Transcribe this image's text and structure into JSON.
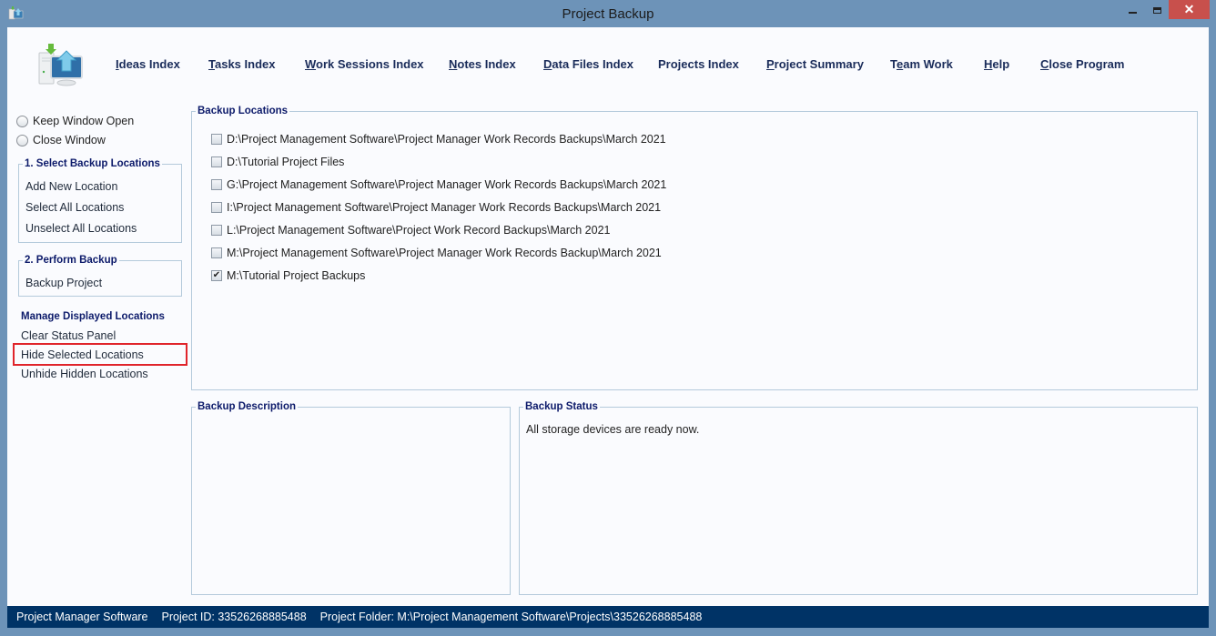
{
  "window": {
    "title": "Project Backup",
    "minimize_icon": "minimize-icon",
    "maximize_icon": "maximize-icon",
    "close_glyph": "✕"
  },
  "menu": [
    {
      "label": "Ideas Index",
      "mnemonic": "I"
    },
    {
      "label": "Tasks Index",
      "mnemonic": "T"
    },
    {
      "label": "Work Sessions Index",
      "mnemonic": "W"
    },
    {
      "label": "Notes Index",
      "mnemonic": "N"
    },
    {
      "label": "Data Files Index",
      "mnemonic": "D"
    },
    {
      "label": "Projects Index",
      "mnemonic": ""
    },
    {
      "label": "Project Summary",
      "mnemonic": "P"
    },
    {
      "label": "Team Work",
      "mnemonic": "e"
    },
    {
      "label": "Help",
      "mnemonic": "H"
    },
    {
      "label": "Close Program",
      "mnemonic": "C"
    }
  ],
  "sidebar": {
    "radios": [
      {
        "label": "Keep Window Open",
        "selected": false
      },
      {
        "label": "Close Window",
        "selected": false
      }
    ],
    "select_group": {
      "title": "1. Select Backup Locations",
      "links": [
        "Add New Location",
        "Select All Locations",
        "Unselect All Locations"
      ]
    },
    "perform_group": {
      "title": "2. Perform Backup",
      "links": [
        "Backup Project"
      ]
    },
    "manage": {
      "title": "Manage Displayed Locations",
      "links": [
        "Clear Status Panel",
        "Hide Selected Locations",
        "Unhide Hidden Locations"
      ],
      "highlighted": "Hide Selected Locations"
    }
  },
  "backup_locations": {
    "title": "Backup Locations",
    "items": [
      {
        "path": "D:\\Project Management Software\\Project Manager Work Records Backups\\March 2021",
        "checked": false
      },
      {
        "path": "D:\\Tutorial Project Files",
        "checked": false
      },
      {
        "path": "G:\\Project Management Software\\Project Manager Work Records Backups\\March 2021",
        "checked": false
      },
      {
        "path": "I:\\Project Management Software\\Project Manager Work Records Backups\\March 2021",
        "checked": false
      },
      {
        "path": "L:\\Project Management Software\\Project Work Record Backups\\March 2021",
        "checked": false
      },
      {
        "path": "M:\\Project Management Software\\Project Manager Work Records Backup\\March 2021",
        "checked": false
      },
      {
        "path": "M:\\Tutorial Project Backups",
        "checked": true
      }
    ]
  },
  "description": {
    "title": "Backup Description",
    "text": ""
  },
  "status": {
    "title": "Backup Status",
    "text": "All storage devices are ready now."
  },
  "statusbar": {
    "app": "Project Manager Software",
    "project_id": "Project ID:  33526268885488",
    "project_folder": "Project Folder: M:\\Project Management Software\\Projects\\33526268885488"
  },
  "colors": {
    "accent": "#003366",
    "frame": "#6d93b8",
    "close": "#c8504c",
    "highlight": "#e0242b"
  }
}
